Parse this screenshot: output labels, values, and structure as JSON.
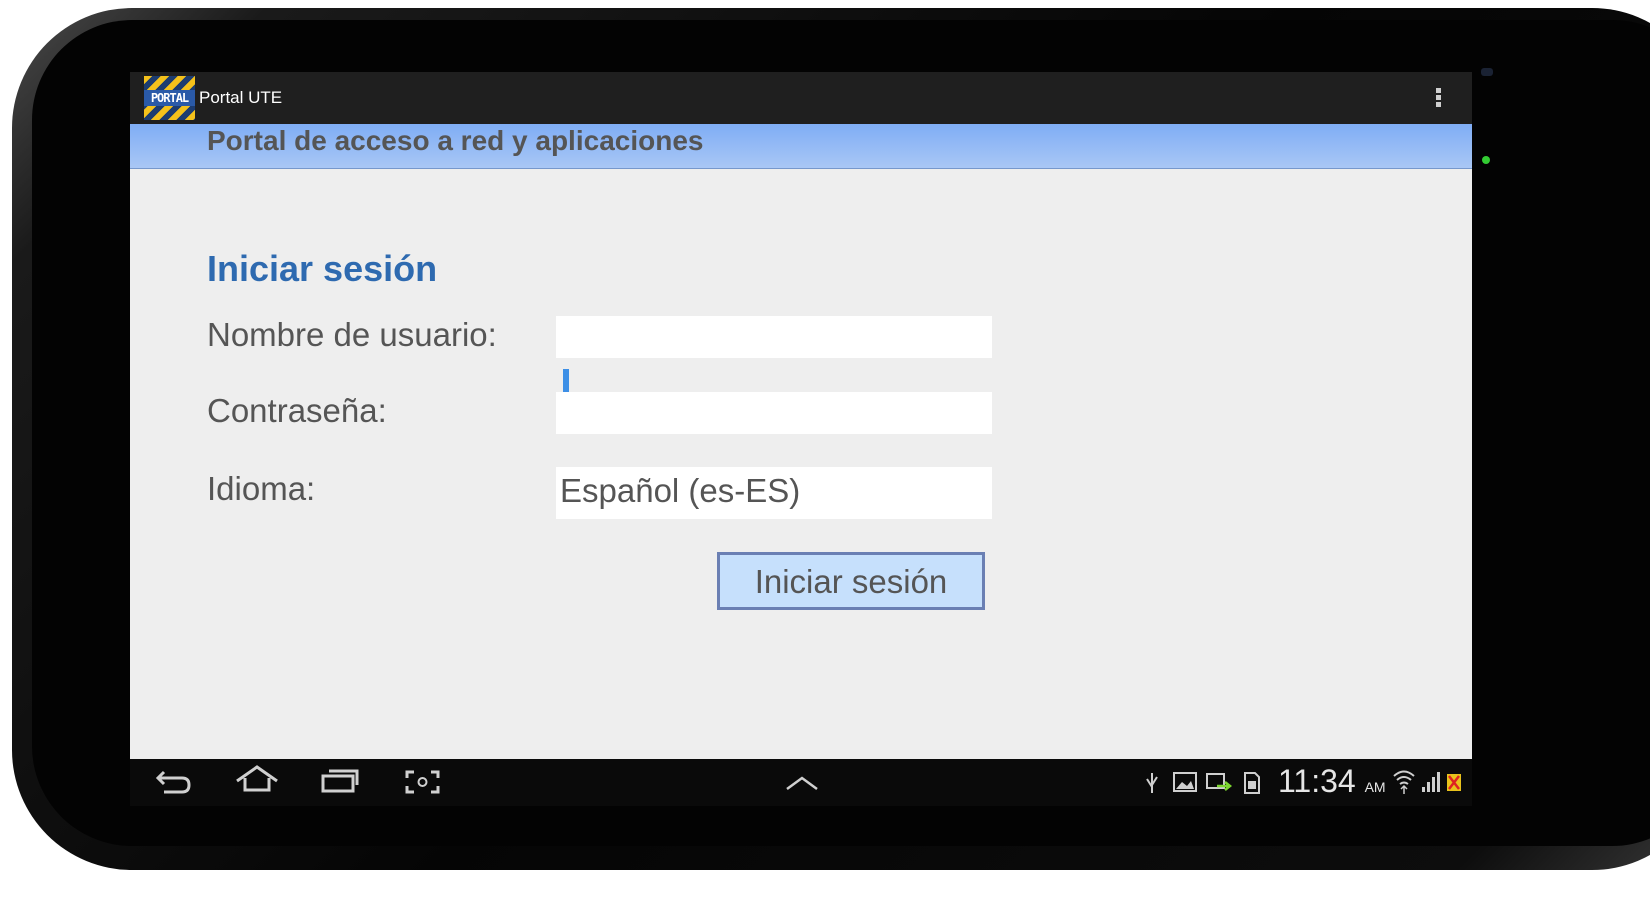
{
  "app": {
    "title": "Portal UTE",
    "logo_text": "PORTAL"
  },
  "header": {
    "title": "Portal de acceso a red y aplicaciones"
  },
  "login": {
    "heading": "Iniciar sesión",
    "username_label": "Nombre de usuario:",
    "username_value": "",
    "password_label": "Contraseña:",
    "password_value": "",
    "language_label": "Idioma:",
    "language_value": "Español (es-ES)",
    "submit_label": "Iniciar sesión"
  },
  "navbar": {
    "buttons": [
      "back-icon",
      "home-icon",
      "recent-apps-icon",
      "screenshot-icon",
      "up-chevron-icon"
    ]
  },
  "status_bar": {
    "time": "11:34",
    "ampm": "AM",
    "icons": [
      "usb-icon",
      "image-icon",
      "sync-icon",
      "sd-card-icon",
      "wifi-icon",
      "signal-icon",
      "no-sim-icon"
    ]
  },
  "colors": {
    "header_gradient_start": "#7fadf5",
    "heading_blue": "#2e6ab0",
    "button_fill": "#c6e0fc",
    "caret": "#3d8fe6",
    "led": "#33cc33"
  }
}
